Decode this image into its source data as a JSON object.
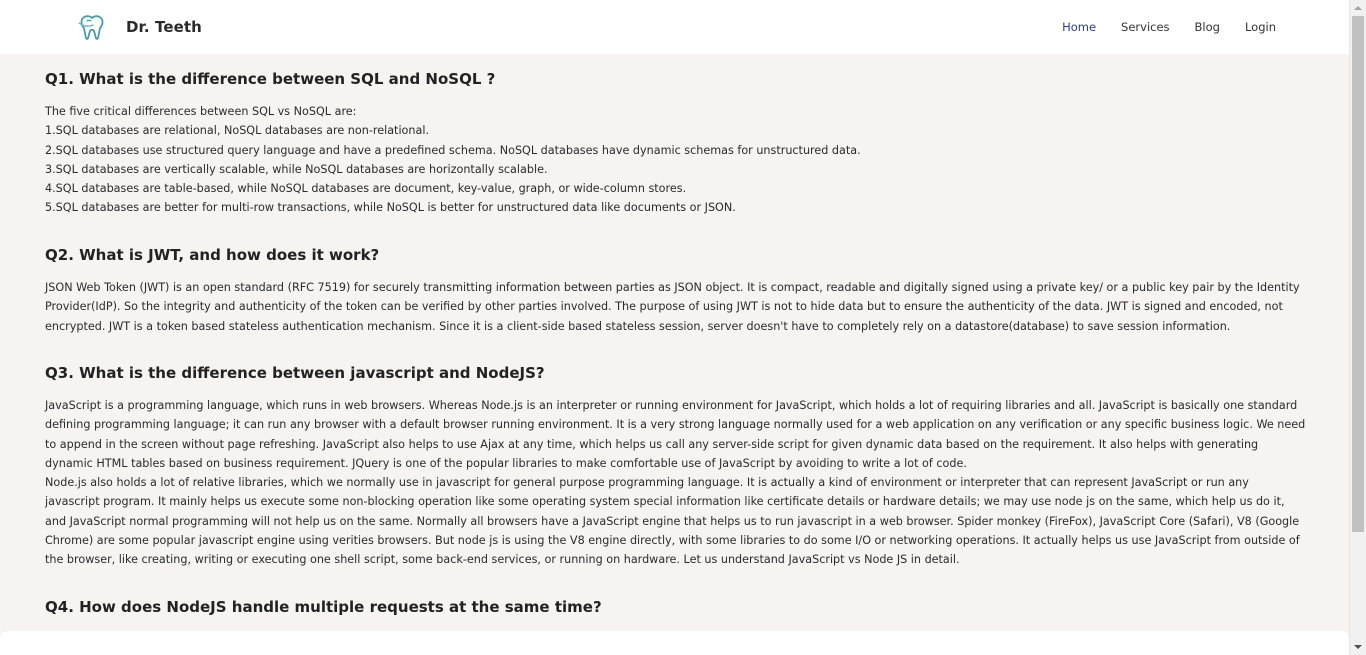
{
  "navbar": {
    "brand_name": "Dr. Teeth",
    "brand_icon": "tooth-logo-icon",
    "links": [
      {
        "label": "Home",
        "active": true
      },
      {
        "label": "Services",
        "active": false
      },
      {
        "label": "Blog",
        "active": false
      },
      {
        "label": "Login",
        "active": false
      }
    ]
  },
  "questions": [
    {
      "title": "Q1. What is the difference between SQL and NoSQL ?",
      "lines": [
        "The five critical differences between SQL vs NoSQL are:",
        "1.SQL databases are relational, NoSQL databases are non-relational.",
        "2.SQL databases use structured query language and have a predefined schema. NoSQL databases have dynamic schemas for unstructured data.",
        "3.SQL databases are vertically scalable, while NoSQL databases are horizontally scalable.",
        "4.SQL databases are table-based, while NoSQL databases are document, key-value, graph, or wide-column stores.",
        "5.SQL databases are better for multi-row transactions, while NoSQL is better for unstructured data like documents or JSON."
      ]
    },
    {
      "title": "Q2. What is JWT, and how does it work?",
      "lines": [
        "JSON Web Token (JWT) is an open standard (RFC 7519) for securely transmitting information between parties as JSON object. It is compact, readable and digitally signed using a private key/ or a public key pair by the Identity Provider(IdP). So the integrity and authenticity of the token can be verified by other parties involved. The purpose of using JWT is not to hide data but to ensure the authenticity of the data. JWT is signed and encoded, not encrypted. JWT is a token based stateless authentication mechanism. Since it is a client-side based stateless session, server doesn't have to completely rely on a datastore(database) to save session information."
      ]
    },
    {
      "title": "Q3. What is the difference between javascript and NodeJS?",
      "lines": [
        "JavaScript is a programming language, which runs in web browsers. Whereas Node.js is an interpreter or running environment for JavaScript, which holds a lot of requiring libraries and all. JavaScript is basically one standard defining programming language; it can run any browser with a default browser running environment. It is a very strong language normally used for a web application on any verification or any specific business logic. We need to append in the screen without page refreshing. JavaScript also helps to use Ajax at any time, which helps us call any server-side script for given dynamic data based on the requirement. It also helps with generating dynamic HTML tables based on business requirement. JQuery is one of the popular libraries to make comfortable use of JavaScript by avoiding to write a lot of code.",
        "Node.js also holds a lot of relative libraries, which we normally use in javascript for general purpose programming language. It is actually a kind of environment or interpreter that can represent JavaScript or run any javascript program. It mainly helps us execute some non-blocking operation like some operating system special information like certificate details or hardware details; we may use node js on the same, which help us do it, and JavaScript normal programming will not help us on the same. Normally all browsers have a JavaScript engine that helps us to run javascript in a web browser. Spider monkey (FireFox), JavaScript Core (Safari), V8 (Google Chrome) are some popular javascript engine using verities browsers. But node js is using the V8 engine directly, with some libraries to do some I/O or networking operations. It actually helps us use JavaScript from outside of the browser, like creating, writing or executing one shell script, some back-end services, or running on hardware. Let us understand JavaScript vs Node JS in detail."
      ]
    },
    {
      "title": "Q4. How does NodeJS handle multiple requests at the same time?",
      "lines": []
    }
  ]
}
